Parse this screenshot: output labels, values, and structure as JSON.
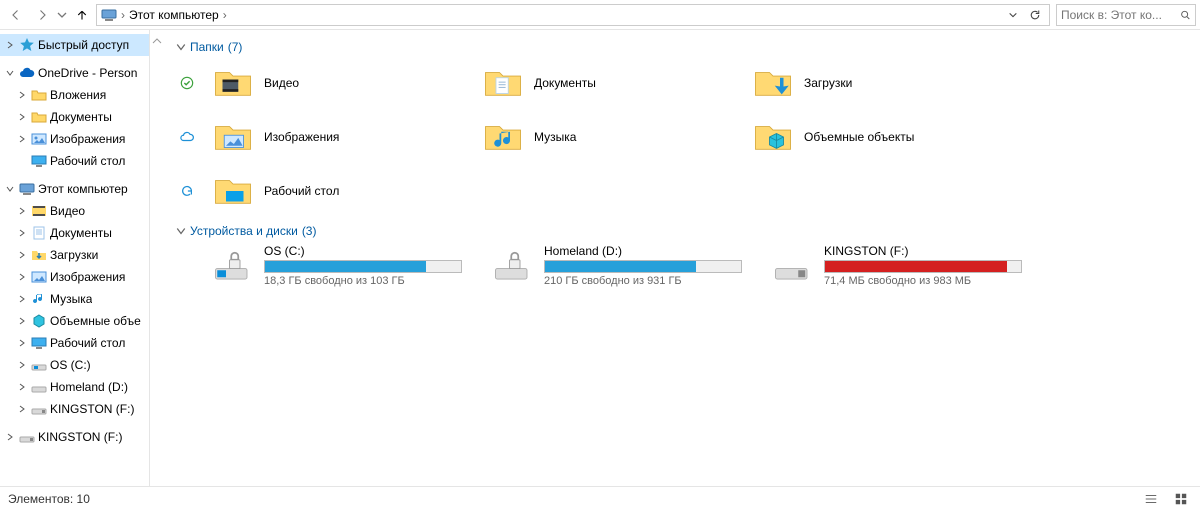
{
  "toolbar": {
    "breadcrumb_root": "Этот компьютер",
    "search_placeholder": "Поиск в: Этот ко..."
  },
  "nav": {
    "quick_access": "Быстрый доступ",
    "onedrive": "OneDrive - Person",
    "onedrive_children": [
      "Вложения",
      "Документы",
      "Изображения",
      "Рабочий стол"
    ],
    "this_pc": "Этот компьютер",
    "this_pc_children": [
      "Видео",
      "Документы",
      "Загрузки",
      "Изображения",
      "Музыка",
      "Объемные объе",
      "Рабочий стол",
      "OS (C:)",
      "Homeland (D:)",
      "KINGSTON (F:)"
    ],
    "kingston": "KINGSTON (F:)"
  },
  "groups": {
    "folders": {
      "label": "Папки",
      "count": "(7)"
    },
    "drives": {
      "label": "Устройства и диски",
      "count": "(3)"
    }
  },
  "folders": [
    {
      "name": "Видео",
      "sync": "ok"
    },
    {
      "name": "Документы",
      "sync": null
    },
    {
      "name": "Загрузки",
      "sync": null
    },
    {
      "name": "Изображения",
      "sync": "cloud"
    },
    {
      "name": "Музыка",
      "sync": null
    },
    {
      "name": "Объемные объекты",
      "sync": null
    },
    {
      "name": "Рабочий стол",
      "sync": "refresh"
    }
  ],
  "drives": [
    {
      "name": "OS (C:)",
      "sub": "18,3 ГБ свободно из 103 ГБ",
      "fill_pct": 82,
      "color": "blue",
      "lock": true
    },
    {
      "name": "Homeland (D:)",
      "sub": "210 ГБ свободно из 931 ГБ",
      "fill_pct": 77,
      "color": "blue",
      "lock": true
    },
    {
      "name": "KINGSTON (F:)",
      "sub": "71,4 МБ свободно из 983 МБ",
      "fill_pct": 93,
      "color": "red",
      "lock": false
    }
  ],
  "status": {
    "items": "Элементов: 10"
  }
}
